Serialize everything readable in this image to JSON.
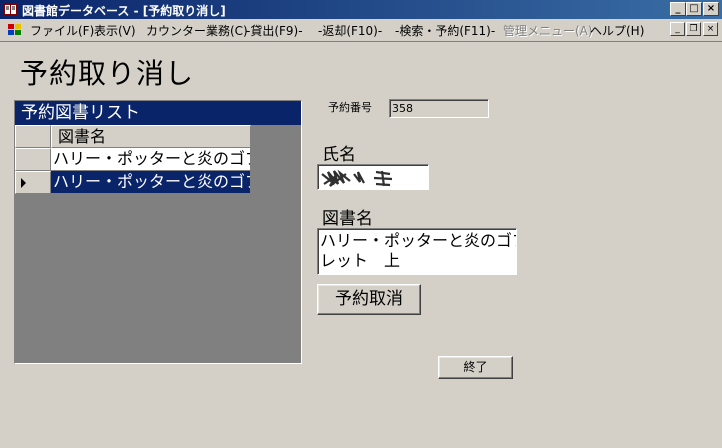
{
  "window": {
    "title": "図書館データベース - [予約取り消し]",
    "caption_buttons": {
      "minimize": "_",
      "maximize": "□",
      "close": "×"
    },
    "mdi_buttons": {
      "minimize": "_",
      "restore": "❐",
      "close": "×"
    }
  },
  "menu": {
    "items": [
      {
        "label": "ファイル(F)",
        "enabled": true
      },
      {
        "label": "表示(V)",
        "enabled": true
      },
      {
        "label": "カウンター業務(C)",
        "enabled": true
      },
      {
        "label": "-貸出(F9)-",
        "enabled": true
      },
      {
        "label": "-返却(F10)-",
        "enabled": true
      },
      {
        "label": "-検索・予約(F11)-",
        "enabled": true
      },
      {
        "label": "管理メニュー(A)",
        "enabled": false
      },
      {
        "label": "ヘルプ(H)",
        "enabled": true
      }
    ]
  },
  "page": {
    "title": "予約取り消し"
  },
  "reservation_list": {
    "caption": "予約図書リスト",
    "column_header": "図書名",
    "rows": [
      {
        "title": "ハリー・ポッターと炎のゴブ",
        "selected": false
      },
      {
        "title": "ハリー・ポッターと炎のゴブ",
        "selected": true
      }
    ]
  },
  "form": {
    "reservation_no_label": "予約番号",
    "reservation_no_value": "358",
    "name_label": "氏名",
    "book_label": "図書名",
    "book_value_line1": "ハリー・ポッターと炎のゴブ",
    "book_value_line2": "レット　上",
    "cancel_button": "予約取消",
    "exit_button": "終了"
  },
  "colors": {
    "window_bg": "#d4d0c8",
    "titlebar_start": "#0a246a",
    "titlebar_end": "#3a6ea5",
    "selection": "#0a246a",
    "grid_bg": "#808080"
  },
  "icons": {
    "app": "books-app-icon",
    "mdi": "document-window-icon",
    "row_indicator": "row-pointer-icon"
  }
}
